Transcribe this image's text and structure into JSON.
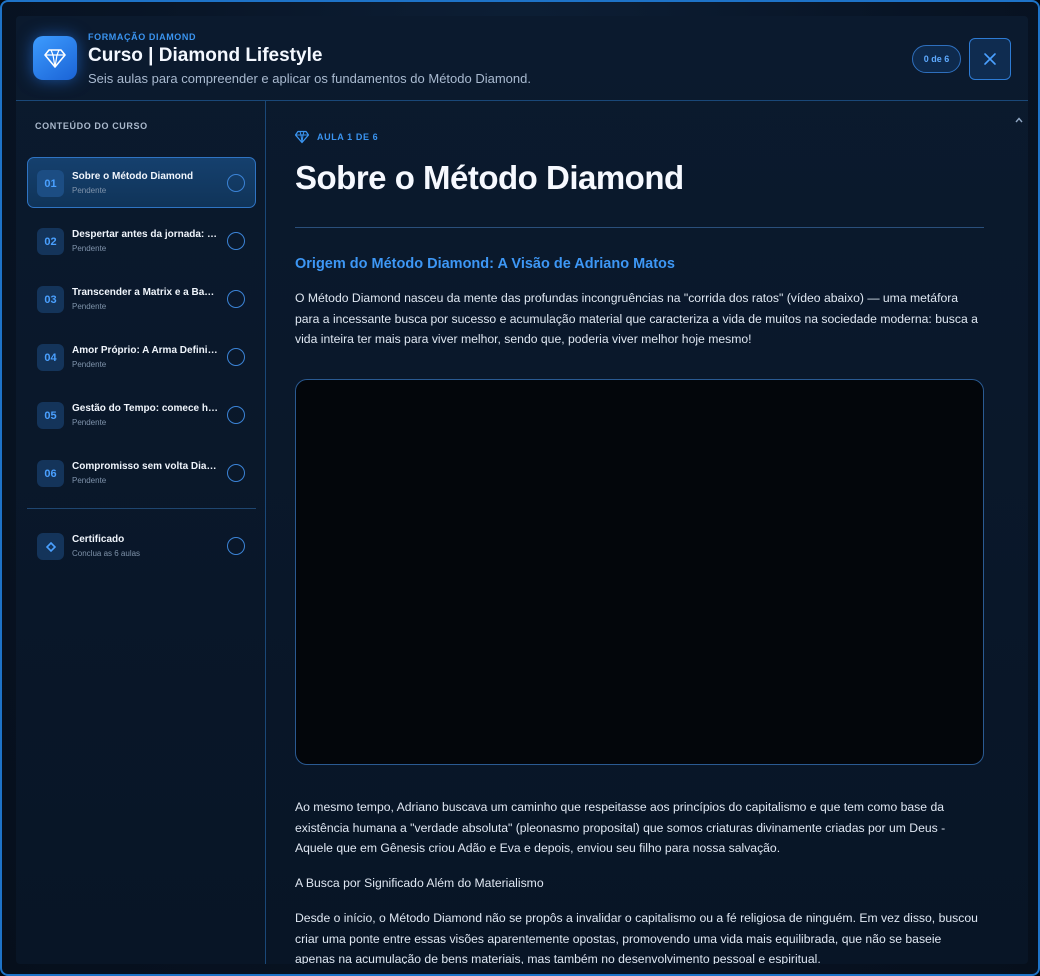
{
  "header": {
    "eyebrow": "FORMAÇÃO DIAMOND",
    "title": "Curso | Diamond Lifestyle",
    "subtitle": "Seis aulas para compreender e aplicar os fundamentos do Método Diamond.",
    "progress": "0 de 6",
    "logo_icon": "diamond-icon",
    "close_icon": "close-icon"
  },
  "sidebar": {
    "heading": "CONTEÚDO DO CURSO",
    "lessons": [
      {
        "num": "01",
        "title": "Sobre o Método Diamond",
        "status": "Pendente",
        "active": true
      },
      {
        "num": "02",
        "title": "Despertar antes da jornada: Raciocínio",
        "status": "Pendente",
        "active": false
      },
      {
        "num": "03",
        "title": "Transcender a Matrix e a Barreira",
        "status": "Pendente",
        "active": false
      },
      {
        "num": "04",
        "title": "Amor Próprio: A Arma Definitiva",
        "status": "Pendente",
        "active": false
      },
      {
        "num": "05",
        "title": "Gestão do Tempo: comece hoje",
        "status": "Pendente",
        "active": false
      },
      {
        "num": "06",
        "title": "Compromisso sem volta Diamond",
        "status": "Pendente",
        "active": false
      }
    ],
    "certificate": {
      "title": "Certificado",
      "status": "Conclua as 6 aulas",
      "icon": "diamond-small-icon"
    }
  },
  "main": {
    "lesson_tag": "AULA 1 DE 6",
    "title": "Sobre o Método Diamond",
    "section_title": "Origem do Método Diamond: A Visão de Adriano Matos",
    "paragraphs": [
      "O Método Diamond nasceu da mente das profundas incongruências na \"corrida dos ratos\" (vídeo abaixo) — uma metáfora para a incessante busca por sucesso e acumulação material que caracteriza a vida de muitos na sociedade moderna: busca a vida inteira ter mais para viver melhor, sendo que, poderia viver melhor hoje mesmo!",
      "Ao mesmo tempo, Adriano buscava um caminho que respeitasse aos princípios do capitalismo e que tem como base da existência humana a \"verdade absoluta\" (pleonasmo proposital) que somos criaturas divinamente criadas por um Deus - Aquele que em Gênesis criou Adão e Eva e depois, enviou seu filho para nossa salvação.",
      "A Busca por Significado Além do Materialismo",
      "Desde o início, o Método Diamond não se propôs a invalidar o capitalismo ou a fé religiosa de ninguém. Em vez disso, buscou criar uma ponte entre essas visões aparentemente opostas, promovendo uma vida mais equilibrada, que não se baseie apenas na acumulação de bens materiais, mas também no desenvolvimento pessoal e espiritual."
    ]
  },
  "colors": {
    "accent": "#3a94f0",
    "panel": "#0b1a2e",
    "border": "#1a4878"
  }
}
